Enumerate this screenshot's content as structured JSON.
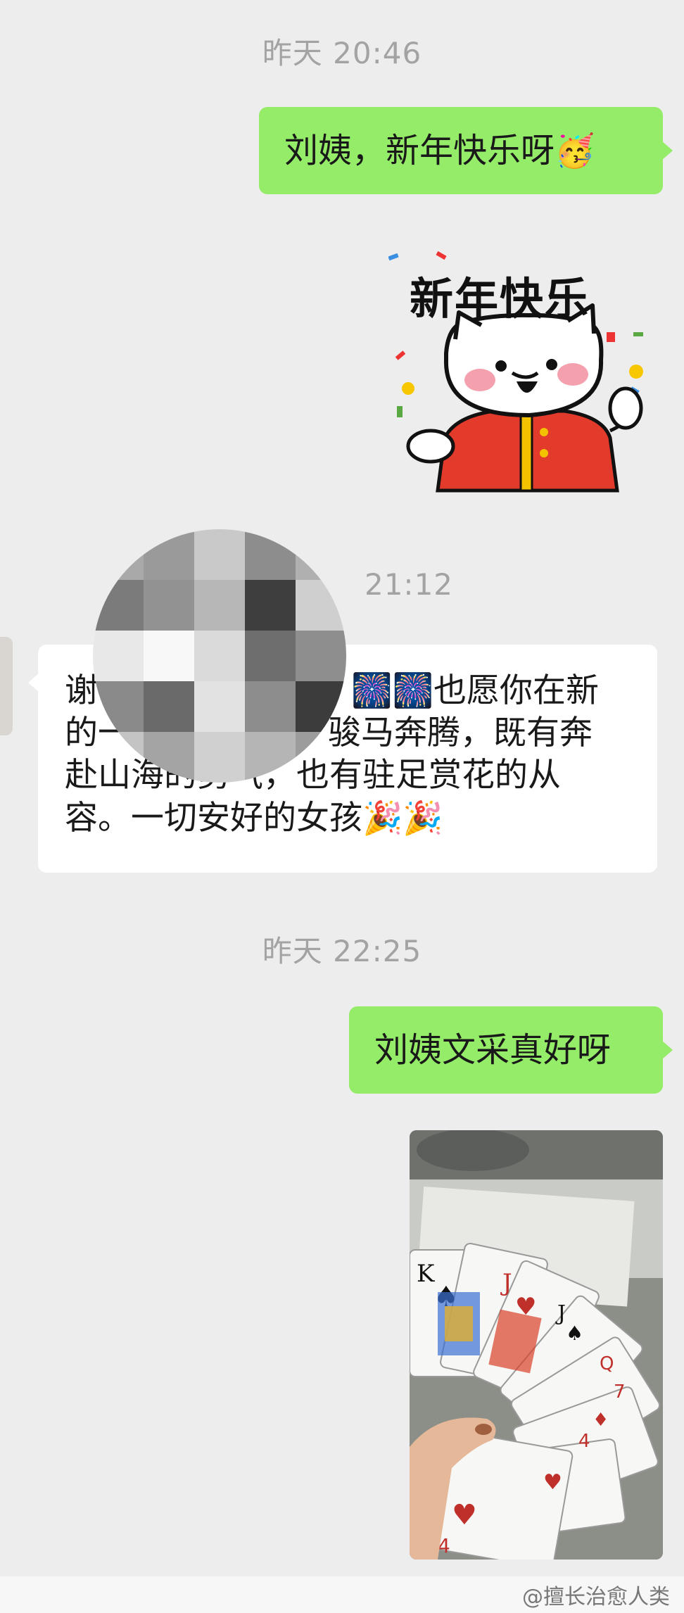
{
  "timestamps": [
    "昨天 20:46",
    "21:12",
    "昨天 22:25"
  ],
  "messages": {
    "m1": {
      "text": "刘姨，新年快乐呀",
      "emoji": "🥳"
    },
    "sticker": {
      "title": "新年快乐"
    },
    "m2": {
      "line1_a": "谢",
      "line1_b": "🎆🎆也愿你在新",
      "line2_a": "的一",
      "line2_b": "骏马奔腾，既有奔",
      "line3_a": "赴山海的勇",
      "line3_b": "气，也有驻足赏花的从",
      "line4": "容。一切安好的女孩",
      "emoji": "🎉🎉"
    },
    "m3": {
      "text": "刘姨文采真好呀"
    }
  },
  "watermark": "@擅长治愈人类",
  "colors": {
    "outgoing": "#95ec69",
    "incoming": "#ffffff",
    "background": "#ededed"
  }
}
